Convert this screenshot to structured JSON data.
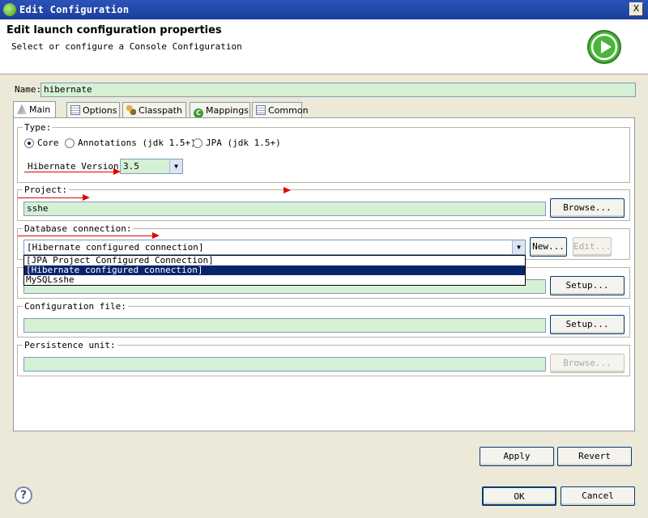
{
  "window": {
    "title": "Edit Configuration",
    "close_glyph": "X"
  },
  "banner": {
    "heading": "Edit launch configuration properties",
    "subtitle": "Select or configure a Console Configuration",
    "icon": "run-icon"
  },
  "name": {
    "label": "Name:",
    "value": "hibernate"
  },
  "tabs": [
    {
      "label": "Main",
      "icon": "main-tab-icon",
      "active": true
    },
    {
      "label": "Options",
      "icon": "options-tab-icon"
    },
    {
      "label": "Classpath",
      "icon": "classpath-tab-icon"
    },
    {
      "label": "Mappings",
      "icon": "mappings-tab-icon"
    },
    {
      "label": "Common",
      "icon": "common-tab-icon"
    }
  ],
  "type_group": {
    "title": "Type:",
    "options": [
      {
        "label": "Core",
        "selected": true
      },
      {
        "label": "Annotations (jdk 1.5+)",
        "selected": false
      },
      {
        "label": "JPA (jdk 1.5+)",
        "selected": false
      }
    ],
    "version_label": "Hibernate Version:",
    "version_value": "3.5"
  },
  "project_group": {
    "title": "Project:",
    "value": "sshe",
    "browse_label": "Browse..."
  },
  "db_group": {
    "title": "Database connection:",
    "value": "[Hibernate configured connection]",
    "new_label": "New...",
    "edit_label": "Edit...",
    "options": [
      {
        "label": "[JPA Project Configured Connection]",
        "selected": false
      },
      {
        "label": "[Hibernate configured connection]",
        "selected": true
      },
      {
        "label": "MySQLsshe",
        "selected": false
      }
    ]
  },
  "properties_group": {
    "setup_label": "Setup..."
  },
  "config_file_group": {
    "title": "Configuration file:",
    "value": "",
    "setup_label": "Setup..."
  },
  "persistence_group": {
    "title": "Persistence unit:",
    "value": "",
    "browse_label": "Browse..."
  },
  "actions": {
    "apply_label": "Apply",
    "revert_label": "Revert",
    "ok_label": "OK",
    "cancel_label": "Cancel"
  },
  "help": {
    "glyph": "?"
  },
  "colors": {
    "field_bg": "#d6f0d6",
    "titlebar": "#2b53b8",
    "selection": "#0a246a",
    "annotation": "#e00000"
  }
}
